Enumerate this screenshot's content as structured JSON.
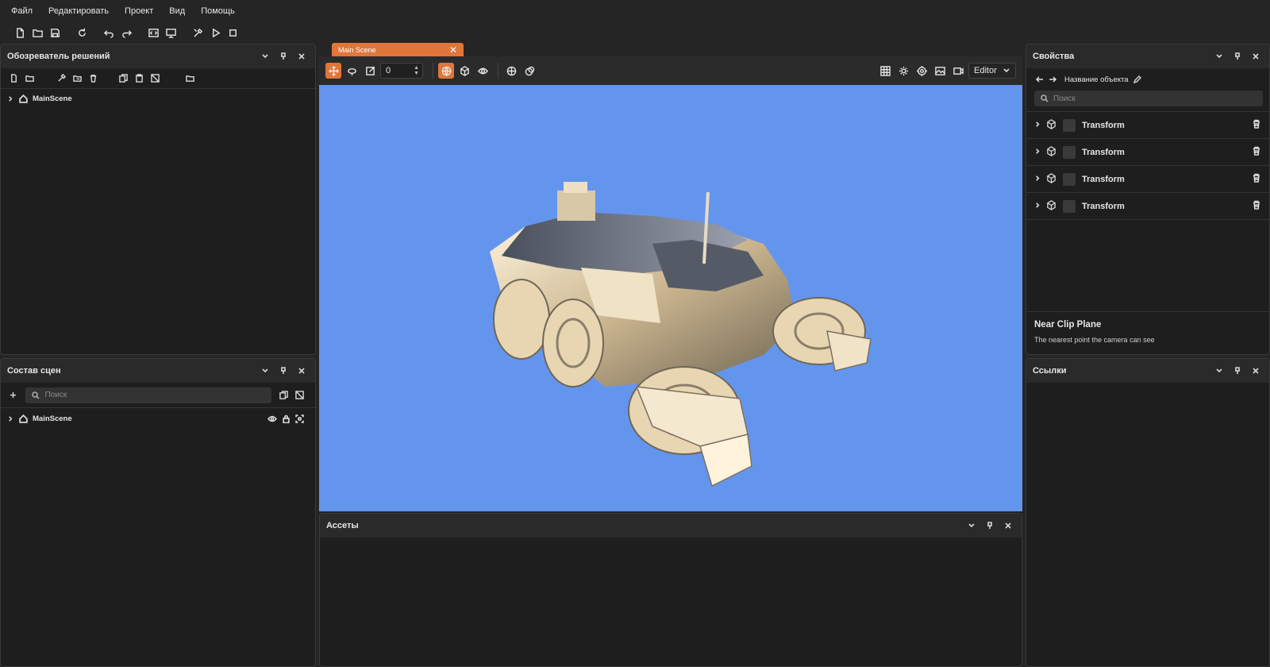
{
  "menu": [
    "Файл",
    "Редактировать",
    "Проект",
    "Вид",
    "Помощь"
  ],
  "solution_explorer": {
    "title": "Обозреватель решений",
    "root_item": "MainScene"
  },
  "scene_composition": {
    "title": "Состав сцен",
    "search_placeholder": "Поиск",
    "root_item": "MainScene"
  },
  "scene_tab": {
    "label": "Main Scene",
    "close": "✕"
  },
  "viewport_toolbar": {
    "snap_value": "0",
    "camera_mode": "Editor"
  },
  "viewport": {
    "background": "#6495ed"
  },
  "properties": {
    "title": "Свойства",
    "object_name": "Название объекта",
    "search_placeholder": "Поиск",
    "components": [
      "Transform",
      "Transform",
      "Transform",
      "Transform"
    ],
    "hint_title": "Near Clip Plane",
    "hint_text": "The nearest point the camera can see"
  },
  "links": {
    "title": "Ссылки"
  },
  "assets": {
    "title": "Ассеты"
  },
  "colors": {
    "accent": "#e0763a",
    "panel": "#1e1e1e",
    "header": "#2a2a2a"
  }
}
